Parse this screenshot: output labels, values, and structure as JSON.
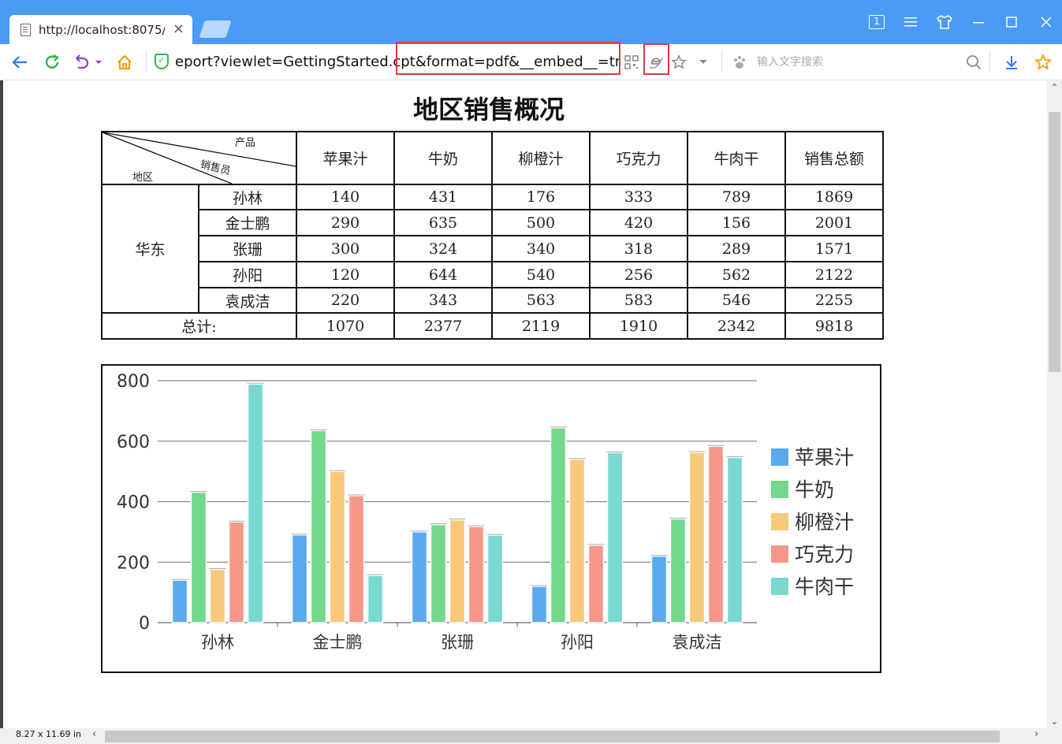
{
  "browser": {
    "tab_title": "http://localhost:8075/",
    "tab_close": "×",
    "address": "eport?viewlet=GettingStarted.cpt&format=pdf&__embed__=true",
    "search_placeholder": "输入文字搜索",
    "window_index": "1"
  },
  "report": {
    "title": "地区销售概况",
    "corner": {
      "product": "产品",
      "salesperson": "销售员",
      "region": "地区"
    },
    "headers": [
      "苹果汁",
      "牛奶",
      "柳橙汁",
      "巧克力",
      "牛肉干",
      "销售总额"
    ],
    "region": "华东",
    "rows": [
      {
        "name": "孙林",
        "values": [
          "140",
          "431",
          "176",
          "333",
          "789",
          "1869"
        ]
      },
      {
        "name": "金士鹏",
        "values": [
          "290",
          "635",
          "500",
          "420",
          "156",
          "2001"
        ]
      },
      {
        "name": "张珊",
        "values": [
          "300",
          "324",
          "340",
          "318",
          "289",
          "1571"
        ]
      },
      {
        "name": "孙阳",
        "values": [
          "120",
          "644",
          "540",
          "256",
          "562",
          "2122"
        ]
      },
      {
        "name": "袁成洁",
        "values": [
          "220",
          "343",
          "563",
          "583",
          "546",
          "2255"
        ]
      }
    ],
    "total_label": "总计:",
    "totals": [
      "1070",
      "2377",
      "2119",
      "1910",
      "2342",
      "9818"
    ]
  },
  "chart_data": {
    "type": "bar",
    "categories": [
      "孙林",
      "金士鹏",
      "张珊",
      "孙阳",
      "袁成洁"
    ],
    "series": [
      {
        "name": "苹果汁",
        "color": "#5aa9ec",
        "values": [
          140,
          290,
          300,
          120,
          220
        ]
      },
      {
        "name": "牛奶",
        "color": "#72d88c",
        "values": [
          431,
          635,
          324,
          644,
          343
        ]
      },
      {
        "name": "柳橙汁",
        "color": "#f8c97a",
        "values": [
          176,
          500,
          340,
          540,
          563
        ]
      },
      {
        "name": "巧克力",
        "color": "#f7978a",
        "values": [
          333,
          420,
          318,
          256,
          583
        ]
      },
      {
        "name": "牛肉干",
        "color": "#79d8d1",
        "values": [
          789,
          156,
          289,
          562,
          546
        ]
      }
    ],
    "y_ticks": [
      "0",
      "200",
      "400",
      "600",
      "800"
    ],
    "ylim": [
      0,
      800
    ],
    "grid": true,
    "legend_position": "right"
  },
  "statusbar": {
    "page_size": "8.27 x 11.69 in"
  }
}
